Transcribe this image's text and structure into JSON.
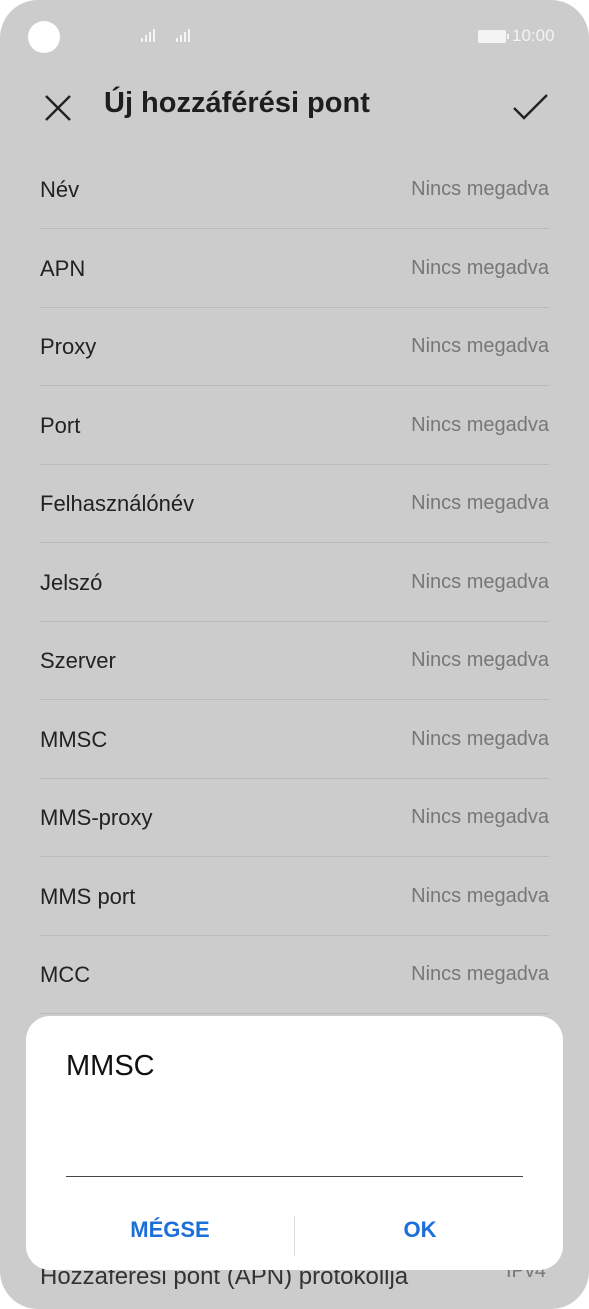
{
  "status_bar": {
    "time": "10:00"
  },
  "header": {
    "title": "Új hozzáférési pont",
    "close_icon": "close-icon",
    "confirm_icon": "check-icon"
  },
  "fields": [
    {
      "label": "Név",
      "value": "Nincs megadva"
    },
    {
      "label": "APN",
      "value": "Nincs megadva"
    },
    {
      "label": "Proxy",
      "value": "Nincs megadva"
    },
    {
      "label": "Port",
      "value": "Nincs megadva"
    },
    {
      "label": "Felhasználónév",
      "value": "Nincs megadva"
    },
    {
      "label": "Jelszó",
      "value": "Nincs megadva"
    },
    {
      "label": "Szerver",
      "value": "Nincs megadva"
    },
    {
      "label": "MMSC",
      "value": "Nincs megadva"
    },
    {
      "label": "MMS-proxy",
      "value": "Nincs megadva"
    },
    {
      "label": "MMS port",
      "value": "Nincs megadva"
    },
    {
      "label": "MCC",
      "value": "Nincs megadva"
    }
  ],
  "partial_row": {
    "label": "Hozzáférési pont (APN) protokollja",
    "value": "IPv4"
  },
  "dialog": {
    "title": "MMSC",
    "input_value": "",
    "cancel_label": "MÉGSE",
    "ok_label": "OK"
  },
  "colors": {
    "accent": "#1b6fd8",
    "background": "#cccccc"
  }
}
